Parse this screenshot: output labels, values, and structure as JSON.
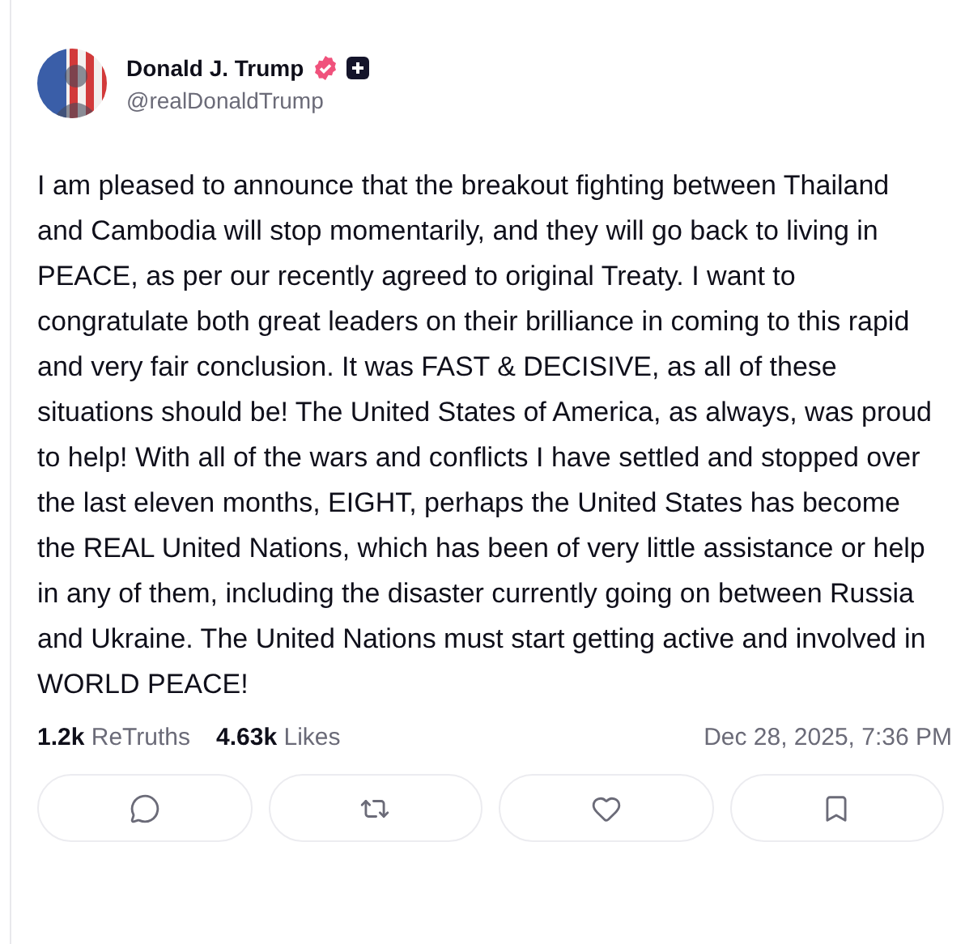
{
  "post": {
    "author": {
      "name": "Donald J. Trump",
      "handle": "@realDonaldTrump",
      "verified": true
    },
    "text": "I am pleased to announce that the breakout fighting between Thailand and Cambodia will stop momentarily, and they will go back to living in PEACE, as per our recently agreed to original Treaty. I want to congratulate both great leaders on their brilliance in coming to this rapid and very fair conclusion. It was FAST & DECISIVE, as all of these situations should be! The United States of America, as always, was proud to help! With all of the wars and conflicts I have settled and stopped over the last eleven months, EIGHT, perhaps the United States has become the REAL United Nations, which has been of very little assistance or help in any of them, including the disaster currently going on between Russia and Ukraine. The United Nations must start getting active and involved in WORLD PEACE!",
    "stats": [
      {
        "count": "1.2k",
        "label": "ReTruths"
      },
      {
        "count": "4.63k",
        "label": "Likes"
      }
    ],
    "timestamp": "Dec 28, 2025, 7:36 PM",
    "actions": [
      {
        "kind": "reply"
      },
      {
        "kind": "retruth"
      },
      {
        "kind": "like"
      },
      {
        "kind": "bookmark"
      }
    ]
  }
}
